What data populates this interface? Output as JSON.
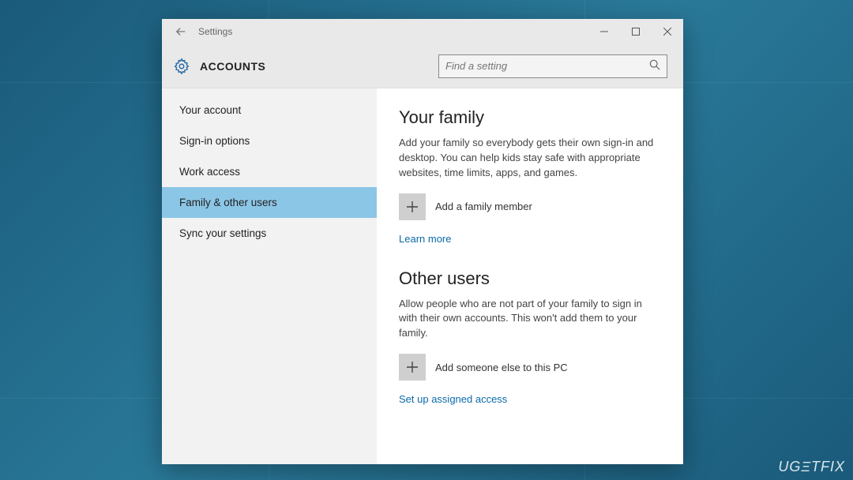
{
  "window": {
    "title": "Settings"
  },
  "header": {
    "section": "ACCOUNTS",
    "search_placeholder": "Find a setting"
  },
  "sidebar": {
    "items": [
      {
        "label": "Your account",
        "active": false
      },
      {
        "label": "Sign-in options",
        "active": false
      },
      {
        "label": "Work access",
        "active": false
      },
      {
        "label": "Family & other users",
        "active": true
      },
      {
        "label": "Sync your settings",
        "active": false
      }
    ]
  },
  "content": {
    "family": {
      "heading": "Your family",
      "description": "Add your family so everybody gets their own sign-in and desktop. You can help kids stay safe with appropriate websites, time limits, apps, and games.",
      "add_label": "Add a family member",
      "learn_more": "Learn more"
    },
    "other": {
      "heading": "Other users",
      "description": "Allow people who are not part of your family to sign in with their own accounts. This won't add them to your family.",
      "add_label": "Add someone else to this PC",
      "assigned_access": "Set up assigned access"
    }
  },
  "watermark": "UGΞTFIX"
}
